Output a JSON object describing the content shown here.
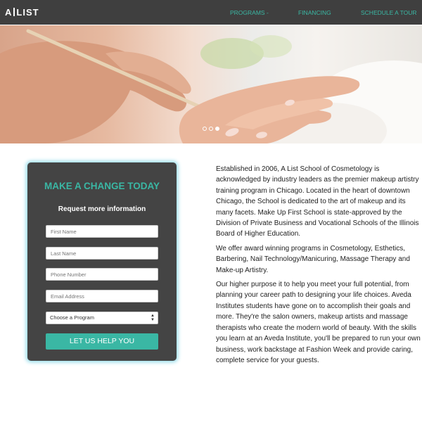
{
  "header": {
    "logo_left": "A",
    "logo_right": "LIST",
    "nav": [
      {
        "label": "PROGRAMS  -"
      },
      {
        "label": "FINANCING"
      },
      {
        "label": "SCHEDULE A TOUR"
      }
    ]
  },
  "hero": {
    "carousel_active_index": 3,
    "carousel_count": 3
  },
  "form": {
    "title": "MAKE A CHANGE TODAY",
    "subtitle": "Request more information",
    "first_name_placeholder": "First Name",
    "last_name_placeholder": "Last Name",
    "phone_placeholder": "Phone Number",
    "email_placeholder": "Email Address",
    "program_select_value": "Choose a Program",
    "submit_label": "LET US HELP YOU"
  },
  "content": {
    "paragraphs": [
      "Established in 2006, A List School of Cosmetology is acknowledged by industry leaders as the premier makeup artistry training program in Chicago. Located in the heart of downtown Chicago, the School is dedicated to the art of makeup and its many facets. Make Up First School is state-approved by the Division of Private Business and Vocational Schools of the Illinois Board of Higher Education.",
      "We offer award winning programs in Cosmetology, Esthetics, Barbering, Nail Technology/Manicuring, Massage Therapy and Make-up Artistry.",
      "Our higher purpose it to help you meet your full potential, from planning your career path to designing your life choices. Aveda Institutes students have gone on to accomplish their goals and more. They're the salon owners, makeup artists and massage therapists who create the modern world of beauty. With the skills you learn at an Aveda Institute, you'll be prepared to run your own business, work backstage at Fashion Week and provide caring, complete service for your guests."
    ]
  },
  "colors": {
    "accent": "#3ab7a4",
    "nav_bg": "#3f3f3f",
    "card_bg": "#444444",
    "card_glow": "#93dcea"
  }
}
